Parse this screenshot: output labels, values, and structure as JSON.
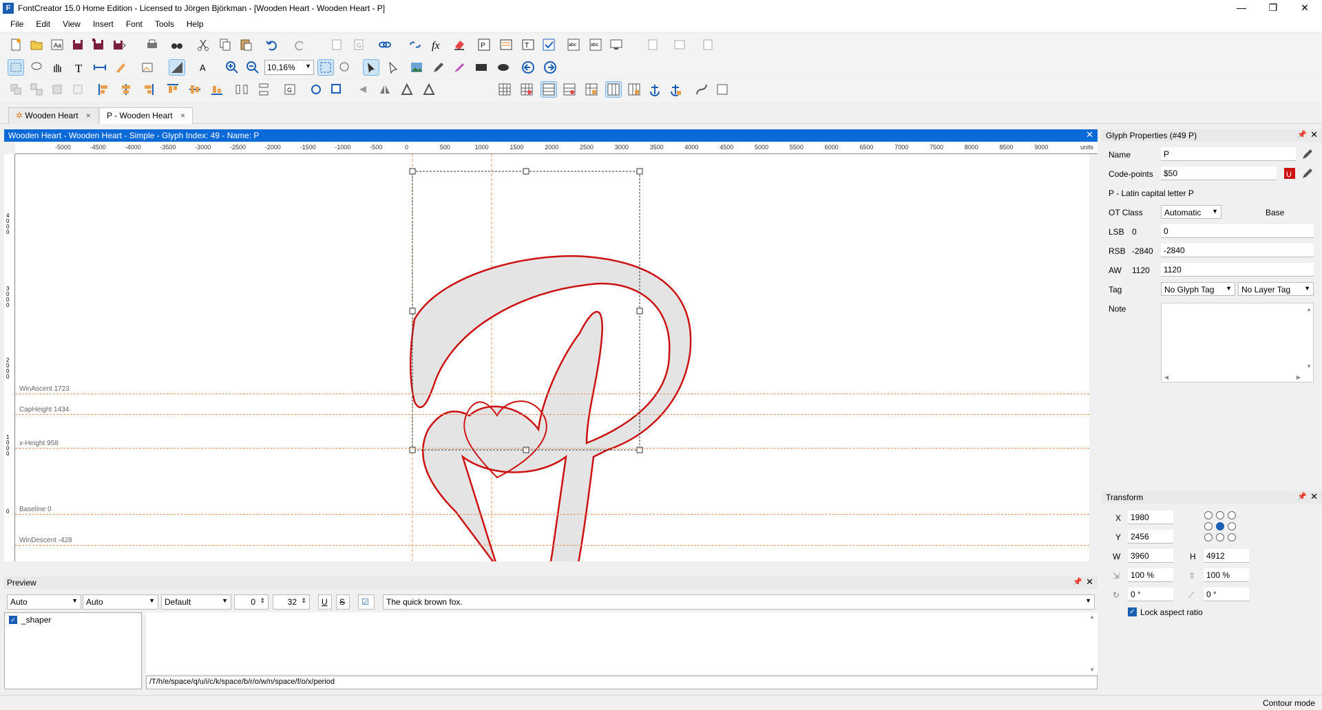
{
  "window": {
    "title": "FontCreator 15.0 Home Edition - Licensed to Jörgen Björkman - [Wooden Heart - Wooden Heart - P]",
    "minimize": "—",
    "maximize": "❐",
    "close": "✕"
  },
  "menu": [
    "File",
    "Edit",
    "View",
    "Insert",
    "Font",
    "Tools",
    "Help"
  ],
  "toolbar": {
    "zoom": "10,16%"
  },
  "tabs": [
    {
      "label": "Wooden Heart",
      "close": "×"
    },
    {
      "label": "P - Wooden Heart",
      "close": "×"
    }
  ],
  "editor": {
    "header": "Wooden Heart - Wooden Heart - Simple - Glyph Index: 49 - Name: P",
    "close": "✕",
    "ruler_ticks": [
      "-5000",
      "-4500",
      "-4000",
      "-3500",
      "-3000",
      "-2500",
      "-2000",
      "-1500",
      "-1000",
      "-500",
      "0",
      "500",
      "1000",
      "1500",
      "2000",
      "2500",
      "3000",
      "3500",
      "4000",
      "4500",
      "5000",
      "5500",
      "6000",
      "6500",
      "7000",
      "7500",
      "8000",
      "8500",
      "9000"
    ],
    "ruler_units": "units",
    "vruler_ticks": [
      "4000",
      "3000",
      "2000",
      "1000",
      "0"
    ],
    "metrics": [
      {
        "label": "WinAscent 1723"
      },
      {
        "label": "CapHeight 1434"
      },
      {
        "label": "x-Height 958"
      },
      {
        "label": "Baseline 0"
      },
      {
        "label": "WinDescent -428"
      }
    ]
  },
  "glyph_properties": {
    "header": "Glyph Properties (#49 P)",
    "name_label": "Name",
    "name_value": "P",
    "codepoints_label": "Code-points",
    "codepoints_value": "$50",
    "description": "P - Latin capital letter P",
    "otclass_label": "OT Class",
    "otclass_value": "Automatic",
    "otclass_base": "Base",
    "lsb_label": "LSB",
    "lsb_current": "0",
    "lsb_value": "0",
    "rsb_label": "RSB",
    "rsb_current": "-2840",
    "rsb_value": "-2840",
    "aw_label": "AW",
    "aw_current": "1120",
    "aw_value": "1120",
    "tag_label": "Tag",
    "glyph_tag": "No Glyph Tag",
    "layer_tag": "No Layer Tag",
    "note_label": "Note"
  },
  "transform": {
    "header": "Transform",
    "x_label": "X",
    "x_value": "1980",
    "y_label": "Y",
    "y_value": "2456",
    "w_label": "W",
    "w_value": "3960",
    "h_label": "H",
    "h_value": "4912",
    "scale_x": "100 %",
    "scale_y": "100 %",
    "rotate": "0 °",
    "skew": "0 °",
    "lock_label": "Lock aspect ratio"
  },
  "preview": {
    "header": "Preview",
    "script": "Auto",
    "language": "Auto",
    "features": "Default",
    "spacing": "0",
    "size": "32",
    "underline": "U",
    "strike": "S",
    "text": "The quick brown fox.",
    "shaper_item": "_shaper",
    "glyph_string": "/T/h/e/space/q/u/i/c/k/space/b/r/o/w/n/space/f/o/x/period"
  },
  "status": {
    "mode": "Contour mode"
  },
  "colors": {
    "accent": "#0a6bd8",
    "contour": "#cc1111",
    "fill": "#e4e4e4",
    "metric": "#e8925a"
  }
}
